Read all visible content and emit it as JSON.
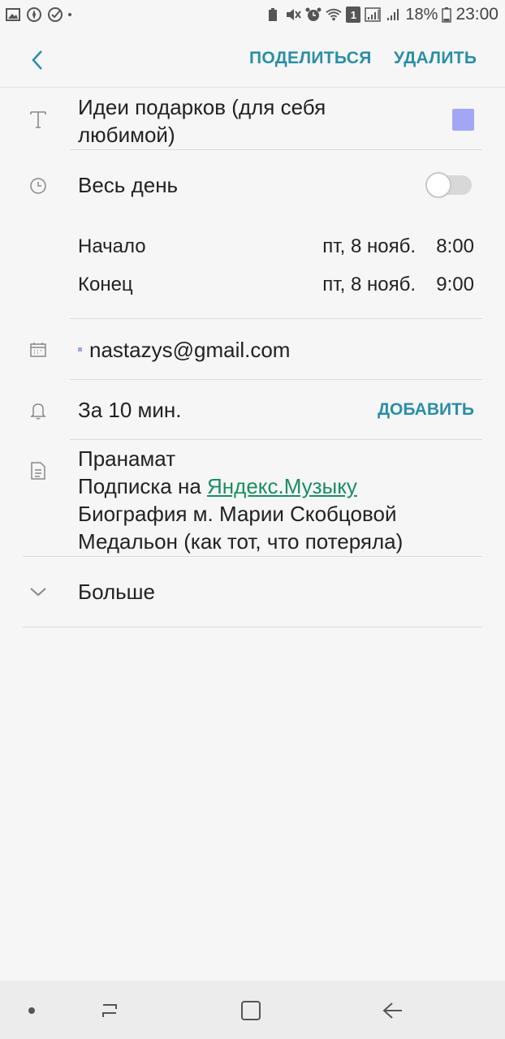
{
  "status_bar": {
    "battery": "18%",
    "time": "23:00",
    "sim_slot": "1"
  },
  "top_bar": {
    "share_label": "ПОДЕЛИТЬСЯ",
    "delete_label": "УДАЛИТЬ"
  },
  "event": {
    "title_line1": "Идеи подарков (для себя",
    "title_line2": "любимой)",
    "color": "#a3a6f5",
    "all_day_label": "Весь день",
    "all_day_on": false,
    "start": {
      "label": "Начало",
      "date": "пт, 8 нояб.",
      "time": "8:00"
    },
    "end": {
      "label": "Конец",
      "date": "пт, 8 нояб.",
      "time": "9:00"
    },
    "calendar_account": "nastazys@gmail.com",
    "reminder": "За 10 мин.",
    "add_reminder_label": "ДОБАВИТЬ",
    "notes": {
      "line1": "Пранамат",
      "line2_prefix": "Подписка на ",
      "line2_link": "Яндекс.Музыку",
      "line3": "Биография м. Марии Скобцовой",
      "line4": "Медальон (как тот, что потеряла)"
    },
    "more_label": "Больше"
  },
  "colors": {
    "accent": "#2b8ea8",
    "link": "#1a8e63",
    "background": "#f6f6f6"
  },
  "icons": {
    "title": "text-format-icon",
    "time": "clock-icon",
    "calendar": "calendar-icon",
    "reminder": "bell-icon",
    "notes": "notes-icon",
    "more": "chevron-down-icon"
  }
}
